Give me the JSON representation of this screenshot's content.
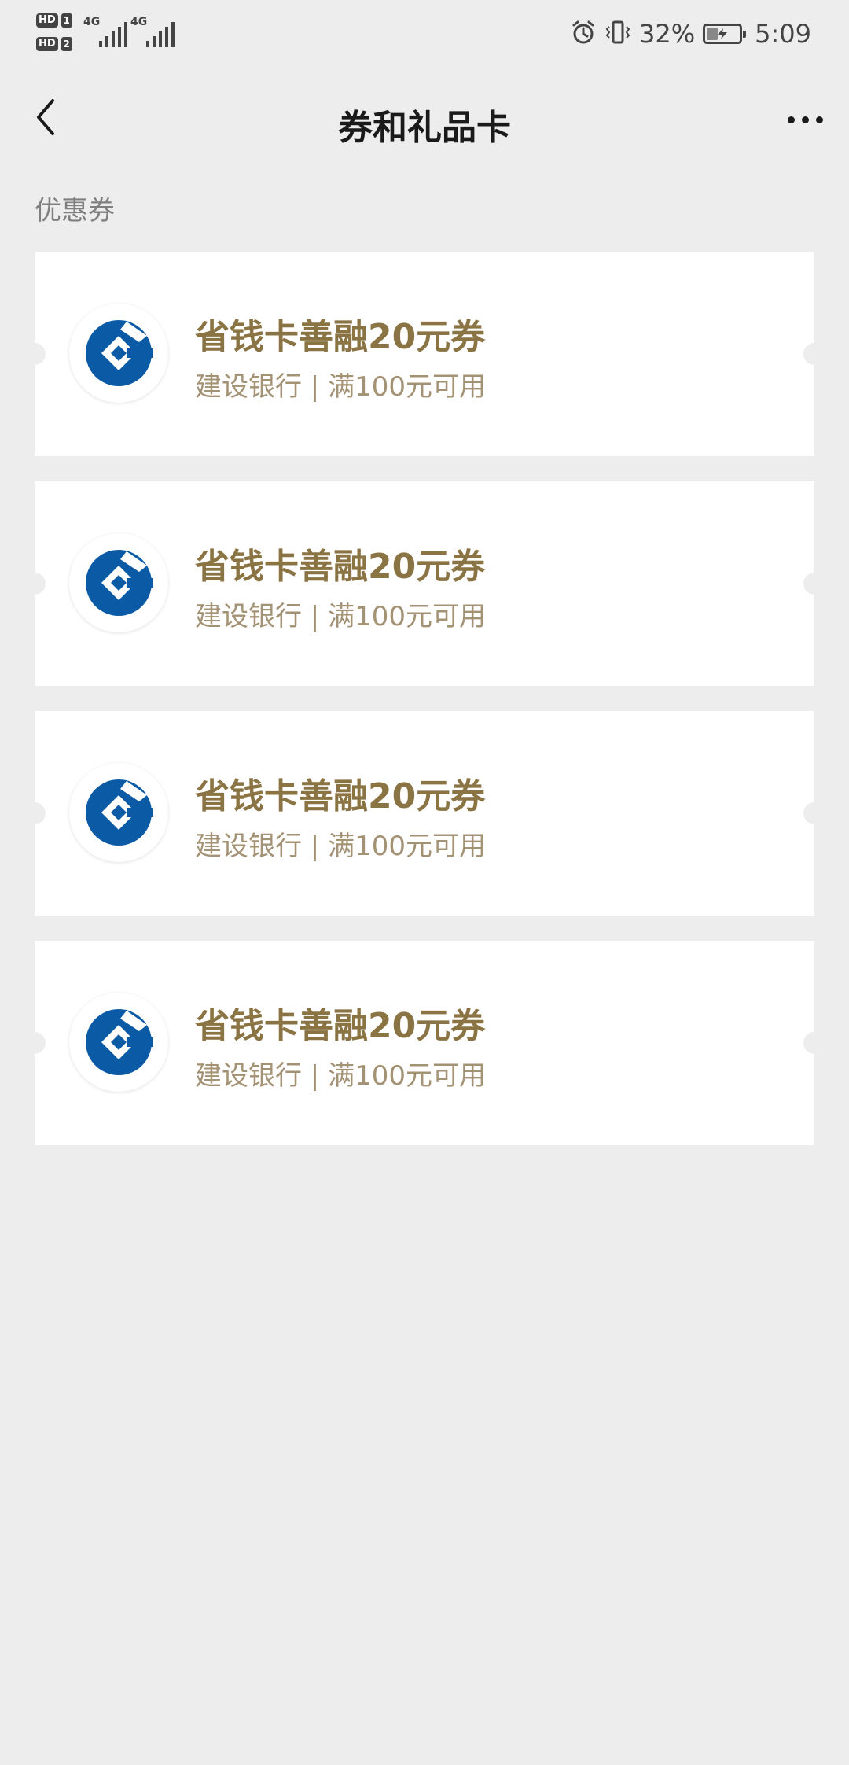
{
  "status_bar": {
    "sim1_label": "HD",
    "sim1_num": "1",
    "sim2_label": "HD",
    "sim2_num": "2",
    "net1": "4G",
    "net2": "4G",
    "battery_percent": "32%",
    "time": "5:09",
    "icons": [
      "alarm-icon",
      "vibrate-icon",
      "battery-charging-icon"
    ]
  },
  "nav": {
    "title": "券和礼品卡",
    "back_icon": "chevron-left-icon",
    "more_icon": "more-dots-icon"
  },
  "section": {
    "label": "优惠券"
  },
  "coupons": [
    {
      "title": "省钱卡善融20元券",
      "subtitle": "建设银行 | 满100元可用",
      "logo": "ccb-logo-icon"
    },
    {
      "title": "省钱卡善融20元券",
      "subtitle": "建设银行 | 满100元可用",
      "logo": "ccb-logo-icon"
    },
    {
      "title": "省钱卡善融20元券",
      "subtitle": "建设银行 | 满100元可用",
      "logo": "ccb-logo-icon"
    },
    {
      "title": "省钱卡善融20元券",
      "subtitle": "建设银行 | 满100元可用",
      "logo": "ccb-logo-icon"
    }
  ],
  "colors": {
    "background": "#ededed",
    "card": "#ffffff",
    "coupon_title": "#8b7443",
    "coupon_sub": "#a39274",
    "ccb_blue": "#0a5aa6"
  }
}
